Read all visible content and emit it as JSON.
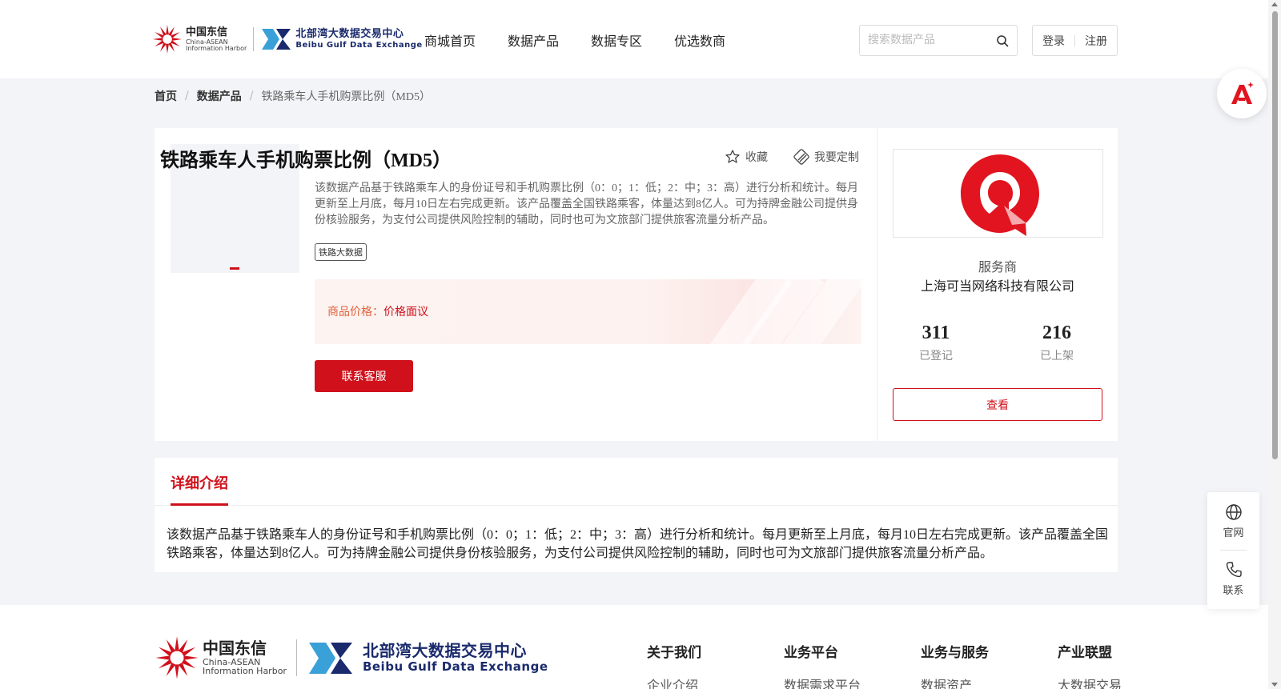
{
  "header": {
    "logo_cn_big": "中国东信",
    "logo_cn_small1": "China-ASEAN",
    "logo_cn_small2": "Information Harbor",
    "logo_bb_big": "北部湾大数据交易中心",
    "logo_bb_small": "Beibu Gulf Data Exchange",
    "nav": [
      "商城首页",
      "数据产品",
      "数据专区",
      "优选数商"
    ],
    "search_placeholder": "搜索数据产品",
    "login": "登录",
    "register": "注册"
  },
  "breadcrumb": [
    "首页",
    "数据产品",
    "铁路乘车人手机购票比例（MD5）"
  ],
  "product": {
    "title": "铁路乘车人手机购票比例（MD5）",
    "favorite": "收藏",
    "customize": "我要定制",
    "description": "该数据产品基于铁路乘车人的身份证号和手机购票比例（0：0；1：低；2：中；3：高）进行分析和统计。每月更新至上月底，每月10日左右完成更新。该产品覆盖全国铁路乘客，体量达到8亿人。可为持牌金融公司提供身份核验服务，为支付公司提供风险控制的辅助，同时也可为文旅部门提供旅客流量分析产品。",
    "tag": "铁路大数据",
    "price_label": "商品价格：",
    "price_value": "价格面议",
    "contact_button": "联系客服"
  },
  "provider": {
    "role": "服务商",
    "name": "上海可当网络科技有限公司",
    "registered_count": "311",
    "registered_label": "已登记",
    "listed_count": "216",
    "listed_label": "已上架",
    "view_button": "查看"
  },
  "detail": {
    "tab": "详细介绍",
    "body": "该数据产品基于铁路乘车人的身份证号和手机购票比例（0：0；1：低；2：中；3：高）进行分析和统计。每月更新至上月底，每月10日左右完成更新。该产品覆盖全国铁路乘客，体量达到8亿人。可为持牌金融公司提供身份核验服务，为支付公司提供风险控制的辅助，同时也可为文旅部门提供旅客流量分析产品。"
  },
  "footer": {
    "columns": [
      {
        "heading": "关于我们",
        "link": "企业介绍"
      },
      {
        "heading": "业务平台",
        "link": "数据需求平台"
      },
      {
        "heading": "业务与服务",
        "link": "数据资产"
      },
      {
        "heading": "产业联盟",
        "link": "大数据交易"
      }
    ]
  },
  "sidebar": {
    "website": "官网",
    "contact": "联系"
  },
  "colors": {
    "accent": "#d0111b",
    "price": "#e0623b",
    "page_bg": "#f3f4f7"
  }
}
